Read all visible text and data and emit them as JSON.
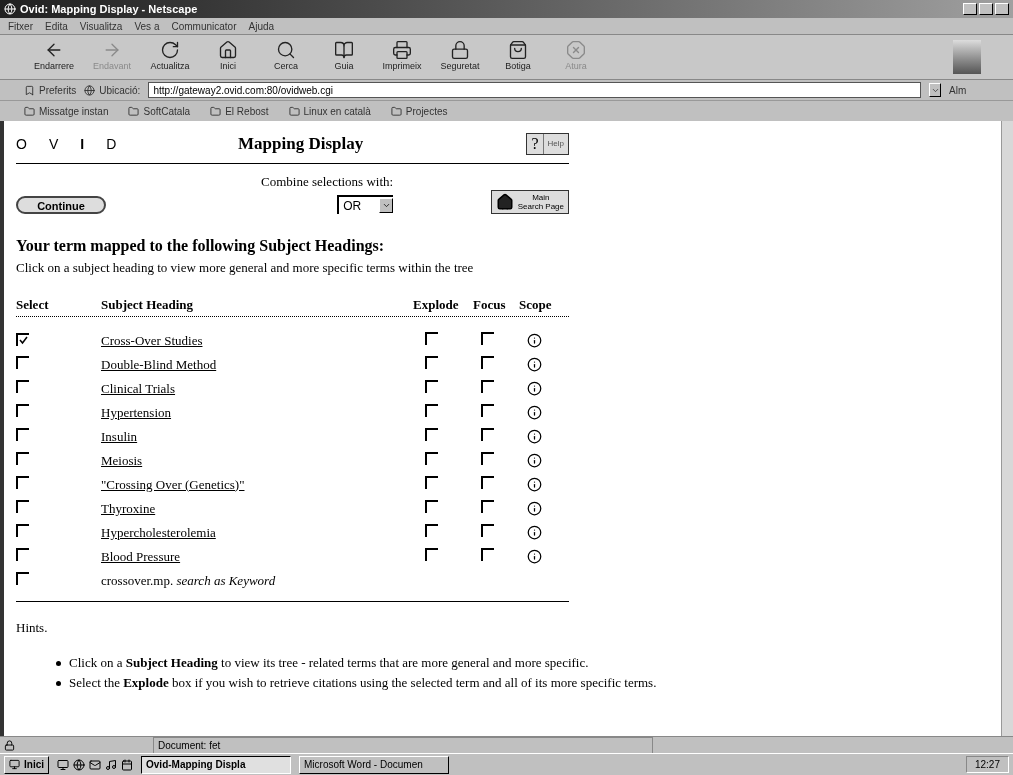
{
  "window": {
    "title": "Ovid: Mapping Display - Netscape"
  },
  "menu": [
    "Fitxer",
    "Edita",
    "Visualitza",
    "Ves a",
    "Communicator",
    "Ajuda"
  ],
  "toolbar": [
    {
      "label": "Endarrere",
      "disabled": false
    },
    {
      "label": "Endavant",
      "disabled": true
    },
    {
      "label": "Actualitza",
      "disabled": false
    },
    {
      "label": "Inici",
      "disabled": false
    },
    {
      "label": "Cerca",
      "disabled": false
    },
    {
      "label": "Guia",
      "disabled": false
    },
    {
      "label": "Imprimeix",
      "disabled": false
    },
    {
      "label": "Seguretat",
      "disabled": false
    },
    {
      "label": "Botiga",
      "disabled": false
    },
    {
      "label": "Atura",
      "disabled": true
    }
  ],
  "location": {
    "bookmarks_label": "Preferits",
    "label": "Ubicació:",
    "url": "http://gateway2.ovid.com:80/ovidweb.cgi",
    "side_label": "Alm"
  },
  "personal_bar": [
    "Missatge instan",
    "SoftCatala",
    "El Rebost",
    "Linux en català",
    "Projectes"
  ],
  "page": {
    "logo": [
      "O",
      "V",
      "I",
      "D"
    ],
    "title": "Mapping Display",
    "help_mark": "?",
    "help_label": "Help",
    "combine_label": "Combine selections with:",
    "combine_value": "OR",
    "continue": "Continue",
    "main_search": [
      "Main",
      "Search Page"
    ],
    "heading": "Your term mapped to the following Subject Headings:",
    "subheading": "Click on a subject heading to view more general and more specific terms within the tree",
    "columns": [
      "Select",
      "Subject Heading",
      "Explode",
      "Focus",
      "Scope"
    ],
    "rows": [
      {
        "kind": "heading",
        "term": "Cross-Over Studies",
        "select": true,
        "explode": false,
        "focus": false
      },
      {
        "kind": "heading",
        "term": "Double-Blind Method",
        "select": false,
        "explode": false,
        "focus": false
      },
      {
        "kind": "heading",
        "term": "Clinical Trials",
        "select": false,
        "explode": false,
        "focus": false
      },
      {
        "kind": "heading",
        "term": "Hypertension",
        "select": false,
        "explode": false,
        "focus": false
      },
      {
        "kind": "heading",
        "term": "Insulin",
        "select": false,
        "explode": false,
        "focus": false
      },
      {
        "kind": "heading",
        "term": "Meiosis",
        "select": false,
        "explode": false,
        "focus": false
      },
      {
        "kind": "heading",
        "term": "\"Crossing Over (Genetics)\"",
        "select": false,
        "explode": false,
        "focus": false
      },
      {
        "kind": "heading",
        "term": "Thyroxine",
        "select": false,
        "explode": false,
        "focus": false
      },
      {
        "kind": "heading",
        "term": "Hypercholesterolemia",
        "select": false,
        "explode": false,
        "focus": false
      },
      {
        "kind": "heading",
        "term": "Blood Pressure",
        "select": false,
        "explode": false,
        "focus": false
      },
      {
        "kind": "keyword",
        "term": "crossover.mp. *search as Keyword*",
        "select": false
      }
    ],
    "hints_title": "Hints.",
    "hints": [
      "Click on a **Subject Heading** to view its tree - related terms that are more general and more specific.",
      "Select the **Explode** box if you wish to retrieve citations using the selected term and all of its more specific terms."
    ]
  },
  "status_bar": {
    "text": "Document: fet"
  },
  "taskbar": {
    "start": "Inici",
    "tasks": [
      {
        "label": "Ovid-Mapping Displa",
        "selected": true
      },
      {
        "label": "Microsoft Word - Documen",
        "selected": false
      }
    ],
    "clock": "12:27"
  }
}
